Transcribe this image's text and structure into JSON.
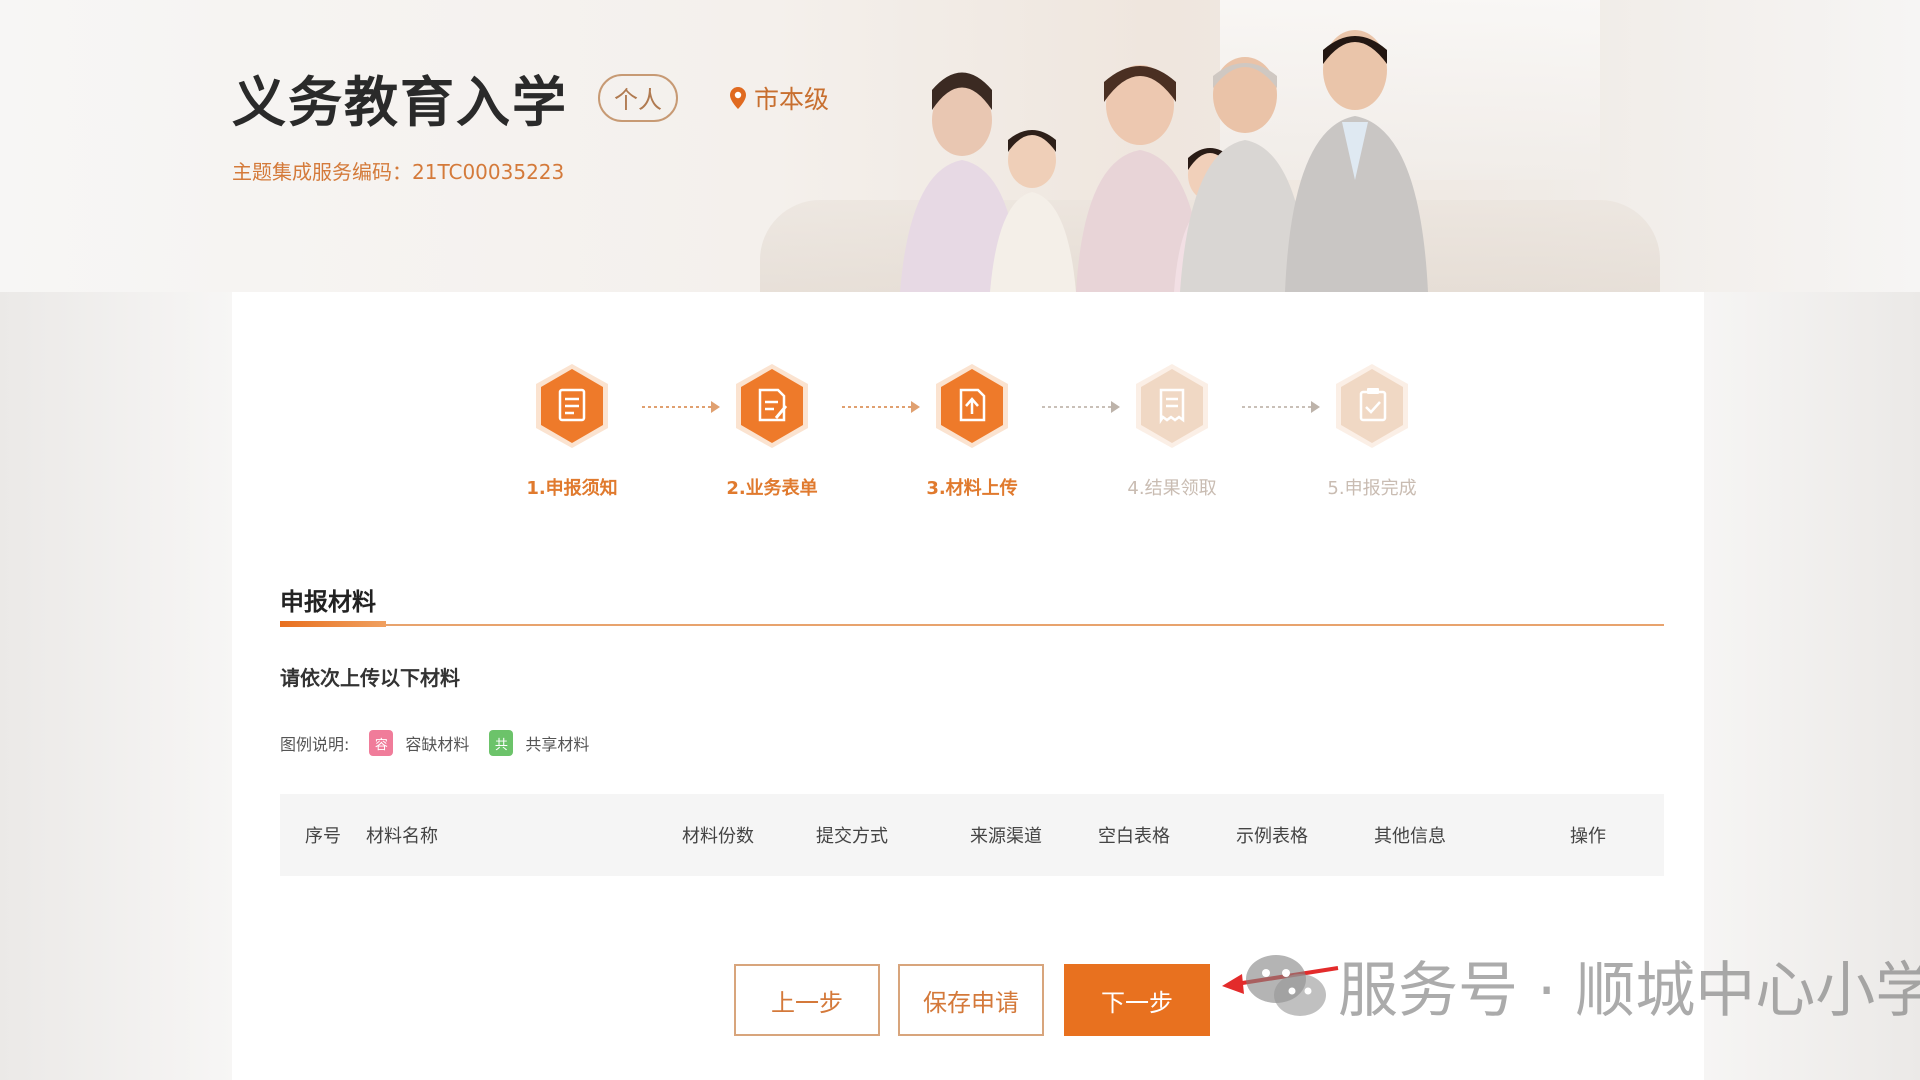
{
  "header": {
    "title": "义务教育入学",
    "tag": "个人",
    "location": "市本级",
    "service_code": "主题集成服务编码：21TC00035223"
  },
  "steps": [
    {
      "label": "1.申报须知",
      "state": "done"
    },
    {
      "label": "2.业务表单",
      "state": "done"
    },
    {
      "label": "3.材料上传",
      "state": "current"
    },
    {
      "label": "4.结果领取",
      "state": "pending"
    },
    {
      "label": "5.申报完成",
      "state": "pending"
    }
  ],
  "section": {
    "title": "申报材料",
    "subtitle": "请依次上传以下材料",
    "legend_label": "图例说明:",
    "legend": [
      {
        "badge": "容",
        "text": "容缺材料",
        "color": "#f07c9a"
      },
      {
        "badge": "共",
        "text": "共享材料",
        "color": "#6cc36a"
      }
    ]
  },
  "table": {
    "columns": [
      "序号",
      "材料名称",
      "材料份数",
      "提交方式",
      "来源渠道",
      "空白表格",
      "示例表格",
      "其他信息",
      "操作"
    ]
  },
  "buttons": {
    "prev": "上一步",
    "save": "保存申请",
    "next": "下一步"
  },
  "watermark": "服务号 · 顺城中心小学",
  "colors": {
    "accent": "#e8711f",
    "step_done": "#ee7a2a",
    "step_pending": "#f0d8c4"
  }
}
